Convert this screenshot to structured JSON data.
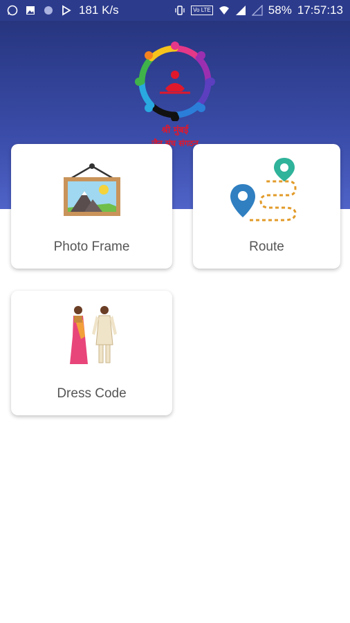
{
  "status_bar": {
    "network_speed": "181 K/s",
    "volte": "Vo LTE",
    "battery": "58%",
    "time": "17:57:13"
  },
  "header": {
    "logo_line1": "श्री मुंबई",
    "logo_line2": "जैन संघ संगठन"
  },
  "cards": {
    "photo_frame": "Photo Frame",
    "route": "Route",
    "dress_code": "Dress Code"
  },
  "colors": {
    "header_top": "#27357f",
    "header_bottom": "#4f63c8",
    "route_pin_blue": "#2f7fc1",
    "route_pin_green": "#2fb39a",
    "route_path": "#e29b2a"
  }
}
